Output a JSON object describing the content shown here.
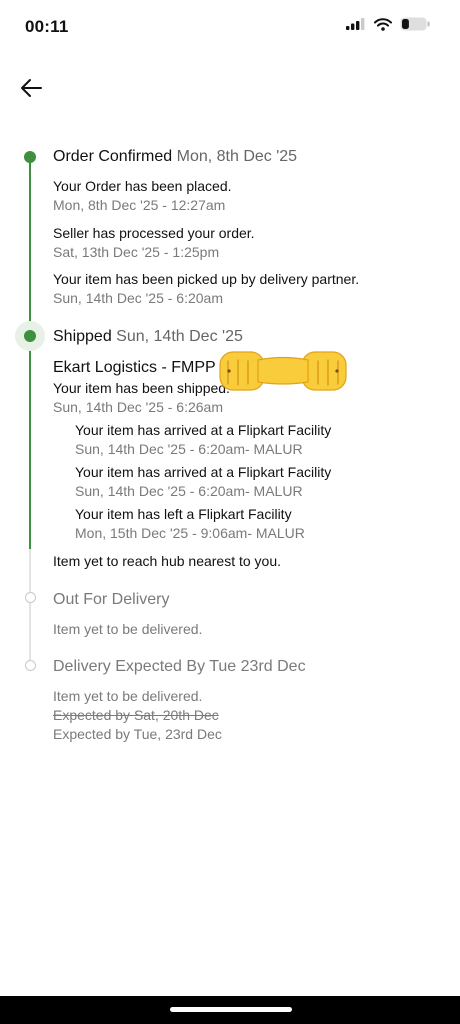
{
  "status_bar": {
    "time": "00:11"
  },
  "tracking": {
    "confirmed": {
      "title": "Order Confirmed",
      "date": "Mon, 8th Dec '25",
      "events": [
        {
          "text": "Your Order has been placed.",
          "time": "Mon, 8th Dec '25 - 12:27am"
        },
        {
          "text": "Seller has processed your order.",
          "time": "Sat, 13th Dec '25 - 1:25pm"
        },
        {
          "text": "Your item has been picked up by delivery partner.",
          "time": "Sun, 14th Dec '25 - 6:20am"
        }
      ]
    },
    "shipped": {
      "title": "Shipped",
      "date": "Sun, 14th Dec '25",
      "courier": "Ekart Logistics - FMPP",
      "event": {
        "text": "Your item has been shipped.",
        "time": "Sun, 14th Dec '25 - 6:26am"
      },
      "sub_events": [
        {
          "text": "Your item has arrived at a Flipkart Facility",
          "time": "Sun, 14th Dec '25 - 6:20am- MALUR"
        },
        {
          "text": "Your item has arrived at a Flipkart Facility",
          "time": "Sun, 14th Dec '25 - 6:20am- MALUR"
        },
        {
          "text": "Your item has left a Flipkart Facility",
          "time": "Mon, 15th Dec '25 - 9:06am- MALUR"
        }
      ],
      "pending_note": "Item yet to reach hub nearest to you."
    },
    "out_for_delivery": {
      "title": "Out For Delivery",
      "note": "Item yet to be delivered."
    },
    "delivery": {
      "title": "Delivery Expected By Tue 23rd Dec",
      "note": "Item yet to be delivered.",
      "old_expected": "Expected by Sat, 20th Dec",
      "new_expected": "Expected by Tue, 23rd Dec"
    }
  },
  "colors": {
    "accent": "#3e8f3e",
    "muted_text": "#7a7a7a",
    "pending_rail": "#e4e4e4"
  },
  "icons": {
    "back": "arrow-left-icon",
    "signal": "cellular-signal-icon",
    "wifi": "wifi-icon",
    "battery": "battery-icon",
    "sticker": "fist-bump-emoji"
  },
  "battery_level": 0.3
}
